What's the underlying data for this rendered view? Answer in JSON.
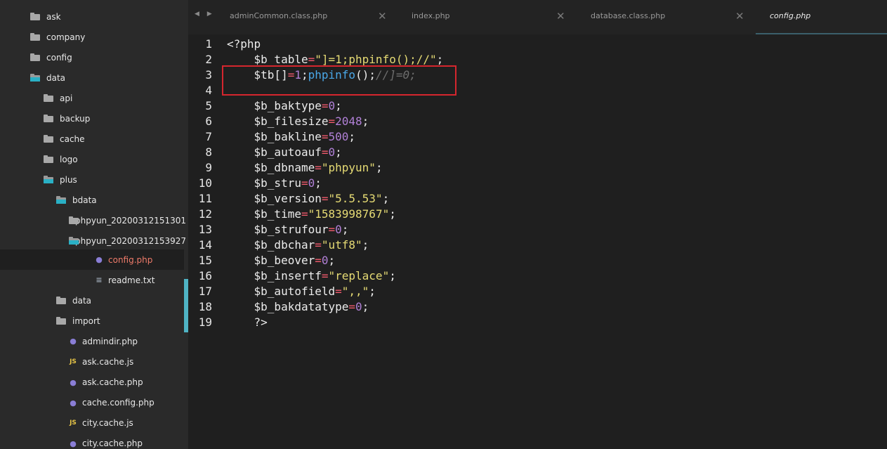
{
  "sidebar": {
    "items": [
      {
        "label": "ask",
        "type": "folder",
        "open": false
      },
      {
        "label": "company",
        "type": "folder",
        "open": false
      },
      {
        "label": "config",
        "type": "folder",
        "open": false
      },
      {
        "label": "data",
        "type": "folder",
        "open": true
      },
      {
        "label": "api",
        "type": "folder",
        "open": false
      },
      {
        "label": "backup",
        "type": "folder",
        "open": false
      },
      {
        "label": "cache",
        "type": "folder",
        "open": false
      },
      {
        "label": "logo",
        "type": "folder",
        "open": false
      },
      {
        "label": "plus",
        "type": "folder",
        "open": true
      },
      {
        "label": "bdata",
        "type": "folder",
        "open": true
      },
      {
        "label": "phpyun_20200312151301",
        "type": "folder",
        "open": false
      },
      {
        "label": "phpyun_20200312153927",
        "type": "folder",
        "open": true
      },
      {
        "label": "config.php",
        "type": "php",
        "selected": true
      },
      {
        "label": "readme.txt",
        "type": "txt"
      },
      {
        "label": "data",
        "type": "folder",
        "open": false
      },
      {
        "label": "import",
        "type": "folder",
        "open": false
      },
      {
        "label": "admindir.php",
        "type": "php"
      },
      {
        "label": "ask.cache.js",
        "type": "js"
      },
      {
        "label": "ask.cache.php",
        "type": "php"
      },
      {
        "label": "cache.config.php",
        "type": "php"
      },
      {
        "label": "city.cache.js",
        "type": "js"
      },
      {
        "label": "city.cache.php",
        "type": "php"
      }
    ],
    "icons": {
      "folder": "folder-icon",
      "php": "php-elephant-icon",
      "js": "js-icon",
      "txt": "text-file-icon"
    },
    "js_badge": "JS"
  },
  "tabs": [
    {
      "label": "adminCommon.class.php",
      "active": false
    },
    {
      "label": "index.php",
      "active": false
    },
    {
      "label": "database.class.php",
      "active": false
    },
    {
      "label": "config.php",
      "active": true
    }
  ],
  "tab_nav": "◀ ▶",
  "close_glyph": "✕",
  "editor": {
    "line_numbers": [
      "1",
      "2",
      "3",
      "4",
      "5",
      "6",
      "7",
      "8",
      "9",
      "10",
      "11",
      "12",
      "13",
      "14",
      "15",
      "16",
      "17",
      "18",
      "19"
    ],
    "lines": [
      [
        {
          "t": "<?php",
          "k": "p"
        }
      ],
      [
        {
          "t": "    $b_table",
          "k": "v"
        },
        {
          "t": "=",
          "k": "o"
        },
        {
          "t": "\"]=1;phpinfo();//\"",
          "k": "s"
        },
        {
          "t": ";",
          "k": "p"
        }
      ],
      [
        {
          "t": "    $tb[]",
          "k": "v"
        },
        {
          "t": "=",
          "k": "o"
        },
        {
          "t": "1",
          "k": "n"
        },
        {
          "t": ";",
          "k": "p"
        },
        {
          "t": "phpinfo",
          "k": "f"
        },
        {
          "t": "();",
          "k": "p"
        },
        {
          "t": "//]=0;",
          "k": "c"
        }
      ],
      [],
      [
        {
          "t": "    $b_baktype",
          "k": "v"
        },
        {
          "t": "=",
          "k": "o"
        },
        {
          "t": "0",
          "k": "n"
        },
        {
          "t": ";",
          "k": "p"
        }
      ],
      [
        {
          "t": "    $b_filesize",
          "k": "v"
        },
        {
          "t": "=",
          "k": "o"
        },
        {
          "t": "2048",
          "k": "n"
        },
        {
          "t": ";",
          "k": "p"
        }
      ],
      [
        {
          "t": "    $b_bakline",
          "k": "v"
        },
        {
          "t": "=",
          "k": "o"
        },
        {
          "t": "500",
          "k": "n"
        },
        {
          "t": ";",
          "k": "p"
        }
      ],
      [
        {
          "t": "    $b_autoauf",
          "k": "v"
        },
        {
          "t": "=",
          "k": "o"
        },
        {
          "t": "0",
          "k": "n"
        },
        {
          "t": ";",
          "k": "p"
        }
      ],
      [
        {
          "t": "    $b_dbname",
          "k": "v"
        },
        {
          "t": "=",
          "k": "o"
        },
        {
          "t": "\"phpyun\"",
          "k": "s"
        },
        {
          "t": ";",
          "k": "p"
        }
      ],
      [
        {
          "t": "    $b_stru",
          "k": "v"
        },
        {
          "t": "=",
          "k": "o"
        },
        {
          "t": "0",
          "k": "n"
        },
        {
          "t": ";",
          "k": "p"
        }
      ],
      [
        {
          "t": "    $b_version",
          "k": "v"
        },
        {
          "t": "=",
          "k": "o"
        },
        {
          "t": "\"5.5.53\"",
          "k": "s"
        },
        {
          "t": ";",
          "k": "p"
        }
      ],
      [
        {
          "t": "    $b_time",
          "k": "v"
        },
        {
          "t": "=",
          "k": "o"
        },
        {
          "t": "\"1583998767\"",
          "k": "s"
        },
        {
          "t": ";",
          "k": "p"
        }
      ],
      [
        {
          "t": "    $b_strufour",
          "k": "v"
        },
        {
          "t": "=",
          "k": "o"
        },
        {
          "t": "0",
          "k": "n"
        },
        {
          "t": ";",
          "k": "p"
        }
      ],
      [
        {
          "t": "    $b_dbchar",
          "k": "v"
        },
        {
          "t": "=",
          "k": "o"
        },
        {
          "t": "\"utf8\"",
          "k": "s"
        },
        {
          "t": ";",
          "k": "p"
        }
      ],
      [
        {
          "t": "    $b_beover",
          "k": "v"
        },
        {
          "t": "=",
          "k": "o"
        },
        {
          "t": "0",
          "k": "n"
        },
        {
          "t": ";",
          "k": "p"
        }
      ],
      [
        {
          "t": "    $b_insertf",
          "k": "v"
        },
        {
          "t": "=",
          "k": "o"
        },
        {
          "t": "\"replace\"",
          "k": "s"
        },
        {
          "t": ";",
          "k": "p"
        }
      ],
      [
        {
          "t": "    $b_autofield",
          "k": "v"
        },
        {
          "t": "=",
          "k": "o"
        },
        {
          "t": "\",,\"",
          "k": "s"
        },
        {
          "t": ";",
          "k": "p"
        }
      ],
      [
        {
          "t": "    $b_bakdatatype",
          "k": "v"
        },
        {
          "t": "=",
          "k": "o"
        },
        {
          "t": "0",
          "k": "n"
        },
        {
          "t": ";",
          "k": "p"
        }
      ],
      [
        {
          "t": "    ?>",
          "k": "p"
        }
      ]
    ]
  },
  "colors": {
    "keyword_operator": "#f25a6d",
    "string": "#e6db74",
    "number": "#b180d7",
    "function": "#4aa8e8",
    "comment": "#6e6e6e",
    "highlight_box": "#d5262e",
    "folder_open": "#2ab0c5"
  }
}
